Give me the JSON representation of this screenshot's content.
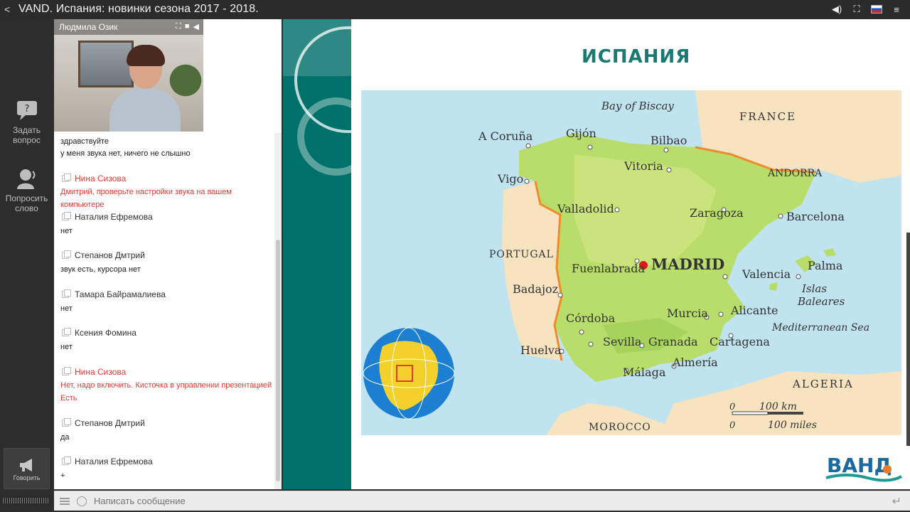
{
  "window": {
    "title": "VAND. Испания: новинки сезона 2017 - 2018."
  },
  "rail": {
    "ask": {
      "line1": "Задать",
      "line2": "вопрос"
    },
    "speak_request": {
      "line1": "Попросить",
      "line2": "слово"
    },
    "speak": "Говорить"
  },
  "video": {
    "presenter": "Людмила Озик"
  },
  "chat": {
    "messages": [
      {
        "author": "",
        "text": "здравствуйте"
      },
      {
        "author": "",
        "text": "у меня звука нет, ничего не слышно"
      },
      {
        "author": "Нина Сизова",
        "text": "Дмитрий, проверьте настройки звука на вашем компьютере",
        "highlight": true
      },
      {
        "author": "Наталия Ефремова",
        "text": "нет"
      },
      {
        "author": "Степанов Дмтрий",
        "text": "звук есть, курсора нет"
      },
      {
        "author": "Тамара Байрамалиева",
        "text": "нет"
      },
      {
        "author": "Ксения Фомина",
        "text": "нет"
      },
      {
        "author": "Нина Сизова",
        "text": "Нет, надо включить. Кисточка в управлении презентацией",
        "text2": "Есть",
        "highlight": true
      },
      {
        "author": "Степанов Дмтрий",
        "text": "да"
      },
      {
        "author": "Наталия Ефремова",
        "text": "+"
      }
    ],
    "input_placeholder": "Написать сообщение"
  },
  "slide": {
    "title": "ИСПАНИЯ",
    "map_labels": {
      "bay": "Bay of Biscay",
      "france": "FRANCE",
      "andorra": "ANDORRA",
      "portugal": "PORTUGAL",
      "algeria": "ALGERIA",
      "morocco": "MOROCCO",
      "med": "Mediterranean Sea",
      "islas": "Islas",
      "baleares": "Baleares",
      "capital": "MADRID",
      "cities": [
        "A Coruña",
        "Gijón",
        "Bilbao",
        "Vitoria",
        "Vigo",
        "Valladolid",
        "Zaragoza",
        "Barcelona",
        "Fuenlabrada",
        "Valencia",
        "Palma",
        "Badajoz",
        "Córdoba",
        "Murcia",
        "Alicante",
        "Sevilla",
        "Granada",
        "Cartagena",
        "Huelva",
        "Almería",
        "Málaga"
      ],
      "scale_km": "100 km",
      "scale_mi": "100 miles",
      "scale_zero": "0"
    },
    "logo": "ВАНД"
  }
}
